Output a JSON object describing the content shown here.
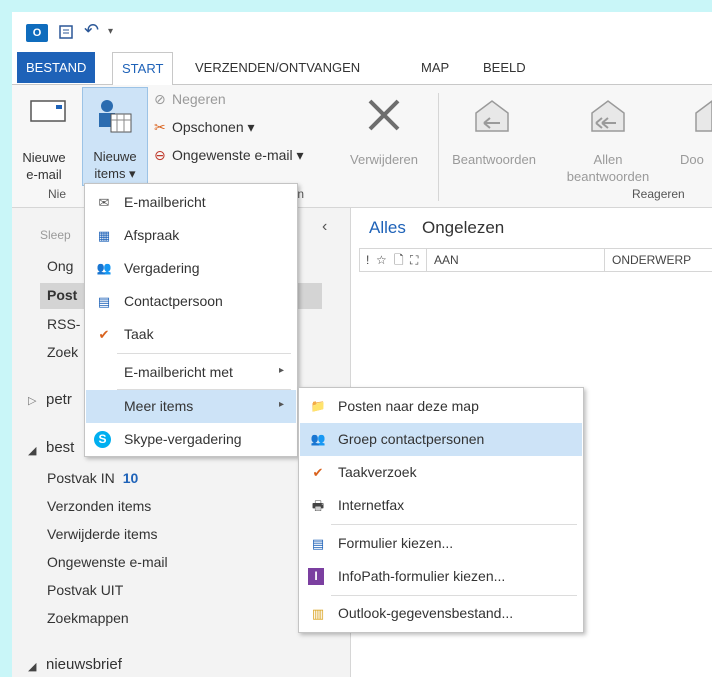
{
  "quick_access": {
    "undo_glyph": "↶",
    "dropdown_glyph": "▾"
  },
  "tabs": [
    "BESTAND",
    "START",
    "VERZENDEN/ONTVANGEN",
    "MAP",
    "BEELD"
  ],
  "ribbon": {
    "new_email": [
      "Nieuwe",
      "e-mail"
    ],
    "new_items": [
      "Nieuwe",
      "items ▾"
    ],
    "ignore": "Negeren",
    "cleanup": "Opschonen ▾",
    "junk": "Ongewenste e-mail ▾",
    "delete": "Verwijderen",
    "reply": "Beantwoorden",
    "reply_all": [
      "Allen",
      "beantwoorden"
    ],
    "forward": "Doo",
    "group_new_partial": "Nie",
    "group_delete_partial": "eren",
    "group_respond": "Reageren"
  },
  "folder_pane": {
    "collapse_glyph": "‹",
    "partial_items": [
      "Sleep",
      "Ong",
      "Post",
      "RSS-",
      "Zoek"
    ],
    "accounts": [
      "petr",
      "best",
      "nieuwsbrief"
    ],
    "folders": [
      "Postvak IN",
      "Verzonden items",
      "Verwijderde items",
      "Ongewenste e-mail",
      "Postvak UIT",
      "Zoekmappen"
    ],
    "inbox_count": "10"
  },
  "message_list": {
    "filters": [
      "Alles",
      "Ongelezen"
    ],
    "icon_headers": [
      "!",
      "☆",
      "🗋",
      "⛶"
    ],
    "col_to": "AAN",
    "col_subject": "ONDERWERP"
  },
  "menu_new": {
    "items": [
      {
        "label": "E-mailbericht",
        "icon": "✉"
      },
      {
        "label": "Afspraak",
        "icon": "▦"
      },
      {
        "label": "Vergadering",
        "icon": "👥"
      },
      {
        "label": "Contactpersoon",
        "icon": "▤"
      },
      {
        "label": "Taak",
        "icon": "✔"
      },
      {
        "label": "E-mailbericht met",
        "icon": ""
      },
      {
        "label": "Meer items",
        "icon": ""
      },
      {
        "label": "Skype-vergadering",
        "icon": "S"
      }
    ],
    "arrow": "▸"
  },
  "menu_more": {
    "items": [
      {
        "label": "Posten naar deze map",
        "icon": "📁"
      },
      {
        "label": "Groep contactpersonen",
        "icon": "👥"
      },
      {
        "label": "Taakverzoek",
        "icon": "✔"
      },
      {
        "label": "Internetfax",
        "icon": "🖶"
      },
      {
        "label": "Formulier kiezen...",
        "icon": "▤"
      },
      {
        "label": "InfoPath-formulier kiezen...",
        "icon": "I"
      },
      {
        "label": "Outlook-gegevensbestand...",
        "icon": "▥"
      }
    ]
  },
  "colors": {
    "accent": "#1e62b8",
    "highlight": "#cde3f7",
    "background": "#c9f6f8"
  }
}
